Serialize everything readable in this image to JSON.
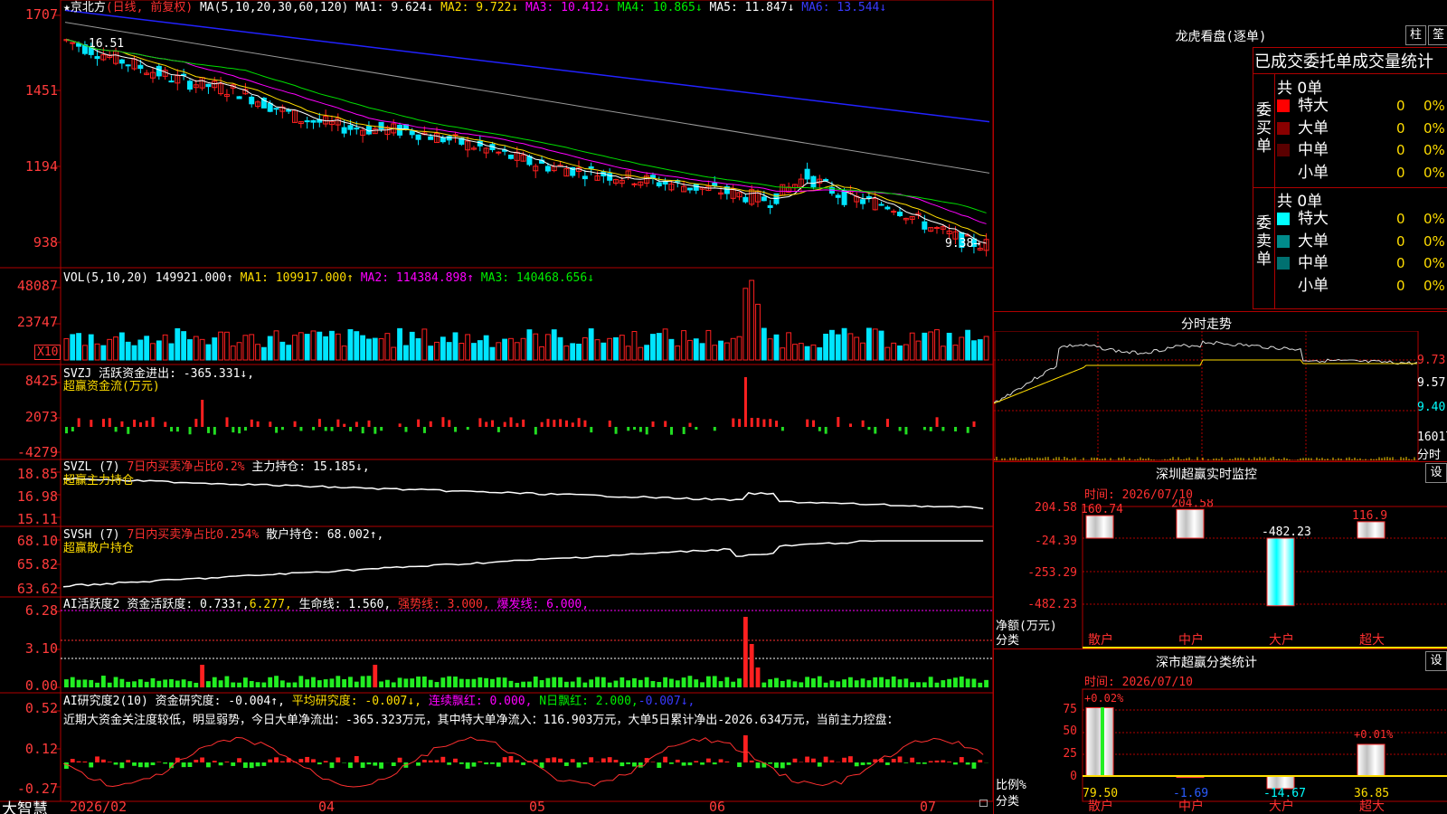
{
  "colors": {
    "up": "#ff2020",
    "down": "#00e5ff",
    "grid": "#b00000",
    "ma1": "#ffffff",
    "ma2": "#ffdd00",
    "ma3": "#ff00ff",
    "ma4": "#00dd00",
    "ma5": "#999999",
    "ma6": "#2222ff"
  },
  "main": {
    "title_star": "★",
    "stock_name": "京北方",
    "period_label": "(日线, 前复权)",
    "ma_label": "MA(5,10,20,30,60,120)",
    "ma1": "MA1: 9.624↓",
    "ma2": "MA2: 9.722↓",
    "ma3": "MA3: 10.412↓",
    "ma4": "MA4: 10.865↓",
    "ma5": "MA5: 11.847↓",
    "ma6": "MA6: 13.544↓",
    "high_annot": "16.51",
    "low_annot": "9.38→",
    "y_ticks": [
      "1707",
      "1451",
      "1194",
      "938"
    ],
    "ylim": [
      8.9,
      17.3
    ]
  },
  "vol": {
    "label": "VOL(5,10,20)",
    "value": "149921.000↑",
    "ma1": "MA1: 109917.000↑",
    "ma2": "MA2: 114384.898↑",
    "ma3": "MA3: 140468.656↓",
    "y_ticks": [
      "48087",
      "23747"
    ],
    "unit": "X10"
  },
  "svzj": {
    "label": "SVZJ",
    "text": "活跃资金进出: -365.331↓,",
    "sub": "超赢资金流(万元)",
    "y_ticks": [
      "8425",
      "2073",
      "-4279"
    ]
  },
  "svzl": {
    "label": "SVZL (7)",
    "red": "7日内买卖净占比0.2%",
    "text": "主力持仓: 15.185↓,",
    "sub": "超赢主力持仓",
    "y_ticks": [
      "18.85",
      "16.98",
      "15.11"
    ]
  },
  "svsh": {
    "label": "SVSH (7)",
    "red": "7日内买卖净占比0.254%",
    "text": "散户持仓: 68.002↑,",
    "sub": "超赢散户持仓",
    "y_ticks": [
      "68.10",
      "65.82",
      "63.62"
    ]
  },
  "ai1": {
    "label": "AI活跃度2",
    "t1": "资金活跃度: 0.733↑,",
    "t2": "6.277,",
    "t3": "生命线: 1.560,",
    "t4": "强势线: 3.000,",
    "t5": "爆发线: 6.000,",
    "y_ticks": [
      "6.28",
      "3.10",
      "0.00"
    ]
  },
  "ai2": {
    "label": "AI研究度2(10)",
    "t1": "资金研究度: -0.004↑,",
    "t2": "平均研究度: -0.007↓,",
    "t3": "连续飘红: 0.000,",
    "t4": "N日飘红: 2.000,",
    "t5": "-0.007↓,",
    "comment": "近期大资金关注度较低，明显弱势，今日大单净流出：-365.323万元，其中特大单净流入：116.903万元，大单5日累计净出-2026.634万元，当前主力控盘：",
    "y_ticks": [
      "0.52",
      "0.12",
      "-0.27"
    ]
  },
  "xaxis": {
    "labels": [
      "2026/02",
      "04",
      "05",
      "06",
      "07"
    ]
  },
  "bottom_left": "大智慧",
  "lhb": {
    "title": "龙虎看盘(逐单)",
    "btn1": "柱",
    "btn2": "筌",
    "tabs": "已成交委托单成交量统计",
    "buy_label": "委买单",
    "sell_label": "委卖单",
    "buy_total": "共 0单",
    "sell_total": "共 0单",
    "buy_rows": [
      {
        "name": "特大",
        "qty": "0",
        "pct": "0%",
        "color": "#ff0000"
      },
      {
        "name": "大单",
        "qty": "0",
        "pct": "0%",
        "color": "#8a0000"
      },
      {
        "name": "中单",
        "qty": "0",
        "pct": "0%",
        "color": "#5a0000"
      },
      {
        "name": "小单",
        "qty": "0",
        "pct": "0%",
        "color": "#000000"
      }
    ],
    "sell_rows": [
      {
        "name": "特大",
        "qty": "0",
        "pct": "0%",
        "color": "#00ffff"
      },
      {
        "name": "大单",
        "qty": "0",
        "pct": "0%",
        "color": "#008b8b"
      },
      {
        "name": "中单",
        "qty": "0",
        "pct": "0%",
        "color": "#007070"
      },
      {
        "name": "小单",
        "qty": "0",
        "pct": "0%",
        "color": "#000000"
      }
    ]
  },
  "fs": {
    "title": "分时走势",
    "y_ticks": [
      "9.73",
      "9.57",
      "9.40"
    ],
    "vol_tick": "16017",
    "vol_unit": "分时"
  },
  "sz": {
    "title": "深圳超赢实时监控",
    "btn": "设",
    "time": "时间: 2026/07/10",
    "y_ticks": [
      "204.58",
      "-24.39",
      "-253.29",
      "-482.23"
    ],
    "y_unit": "净额(万元)",
    "x_unit": "分类",
    "cats": [
      "散户",
      "中户",
      "大户",
      "超大"
    ],
    "values": [
      160.74,
      204.58,
      -482.23,
      116.9
    ],
    "value_labels": [
      "160.74",
      "204.58",
      "-482.23",
      "116.9"
    ]
  },
  "fl": {
    "title": "深市超赢分类统计",
    "btn": "设",
    "time": "时间: 2026/07/10",
    "y_ticks": [
      "75",
      "50",
      "25",
      "0"
    ],
    "y_unit": "比例%",
    "x_unit": "分类",
    "cats": [
      "散户",
      "中户",
      "大户",
      "超大"
    ],
    "values": [
      79.5,
      -1.69,
      -14.67,
      36.85
    ],
    "value_labels": [
      "79.50",
      "-1.69",
      "-14.67",
      "36.85"
    ],
    "top_labels": [
      "+0.02%",
      "+0.01%"
    ]
  }
}
